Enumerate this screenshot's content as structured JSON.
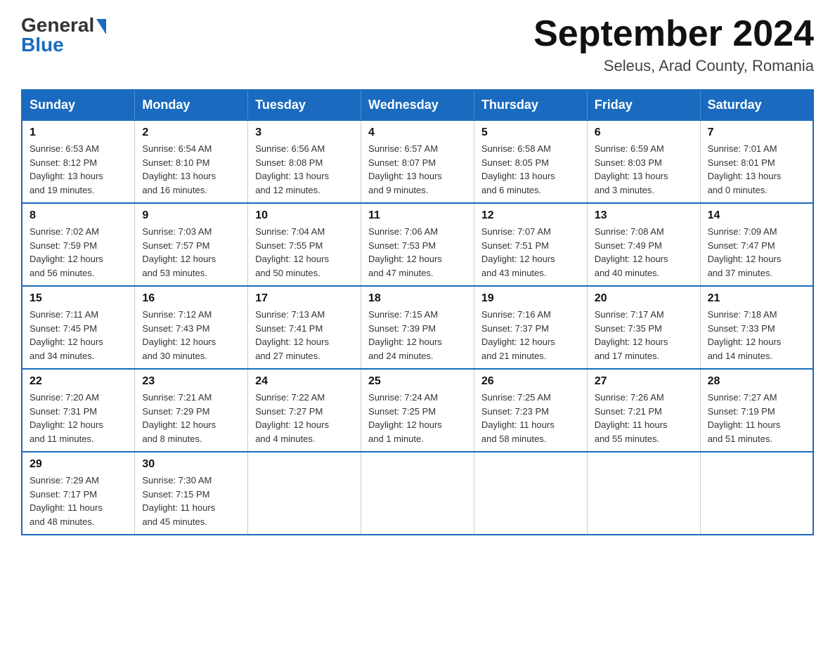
{
  "header": {
    "logo_general": "General",
    "logo_blue": "Blue",
    "month_title": "September 2024",
    "location": "Seleus, Arad County, Romania"
  },
  "calendar": {
    "headers": [
      "Sunday",
      "Monday",
      "Tuesday",
      "Wednesday",
      "Thursday",
      "Friday",
      "Saturday"
    ],
    "weeks": [
      [
        {
          "day": "1",
          "sunrise": "6:53 AM",
          "sunset": "8:12 PM",
          "daylight": "13 hours and 19 minutes."
        },
        {
          "day": "2",
          "sunrise": "6:54 AM",
          "sunset": "8:10 PM",
          "daylight": "13 hours and 16 minutes."
        },
        {
          "day": "3",
          "sunrise": "6:56 AM",
          "sunset": "8:08 PM",
          "daylight": "13 hours and 12 minutes."
        },
        {
          "day": "4",
          "sunrise": "6:57 AM",
          "sunset": "8:07 PM",
          "daylight": "13 hours and 9 minutes."
        },
        {
          "day": "5",
          "sunrise": "6:58 AM",
          "sunset": "8:05 PM",
          "daylight": "13 hours and 6 minutes."
        },
        {
          "day": "6",
          "sunrise": "6:59 AM",
          "sunset": "8:03 PM",
          "daylight": "13 hours and 3 minutes."
        },
        {
          "day": "7",
          "sunrise": "7:01 AM",
          "sunset": "8:01 PM",
          "daylight": "13 hours and 0 minutes."
        }
      ],
      [
        {
          "day": "8",
          "sunrise": "7:02 AM",
          "sunset": "7:59 PM",
          "daylight": "12 hours and 56 minutes."
        },
        {
          "day": "9",
          "sunrise": "7:03 AM",
          "sunset": "7:57 PM",
          "daylight": "12 hours and 53 minutes."
        },
        {
          "day": "10",
          "sunrise": "7:04 AM",
          "sunset": "7:55 PM",
          "daylight": "12 hours and 50 minutes."
        },
        {
          "day": "11",
          "sunrise": "7:06 AM",
          "sunset": "7:53 PM",
          "daylight": "12 hours and 47 minutes."
        },
        {
          "day": "12",
          "sunrise": "7:07 AM",
          "sunset": "7:51 PM",
          "daylight": "12 hours and 43 minutes."
        },
        {
          "day": "13",
          "sunrise": "7:08 AM",
          "sunset": "7:49 PM",
          "daylight": "12 hours and 40 minutes."
        },
        {
          "day": "14",
          "sunrise": "7:09 AM",
          "sunset": "7:47 PM",
          "daylight": "12 hours and 37 minutes."
        }
      ],
      [
        {
          "day": "15",
          "sunrise": "7:11 AM",
          "sunset": "7:45 PM",
          "daylight": "12 hours and 34 minutes."
        },
        {
          "day": "16",
          "sunrise": "7:12 AM",
          "sunset": "7:43 PM",
          "daylight": "12 hours and 30 minutes."
        },
        {
          "day": "17",
          "sunrise": "7:13 AM",
          "sunset": "7:41 PM",
          "daylight": "12 hours and 27 minutes."
        },
        {
          "day": "18",
          "sunrise": "7:15 AM",
          "sunset": "7:39 PM",
          "daylight": "12 hours and 24 minutes."
        },
        {
          "day": "19",
          "sunrise": "7:16 AM",
          "sunset": "7:37 PM",
          "daylight": "12 hours and 21 minutes."
        },
        {
          "day": "20",
          "sunrise": "7:17 AM",
          "sunset": "7:35 PM",
          "daylight": "12 hours and 17 minutes."
        },
        {
          "day": "21",
          "sunrise": "7:18 AM",
          "sunset": "7:33 PM",
          "daylight": "12 hours and 14 minutes."
        }
      ],
      [
        {
          "day": "22",
          "sunrise": "7:20 AM",
          "sunset": "7:31 PM",
          "daylight": "12 hours and 11 minutes."
        },
        {
          "day": "23",
          "sunrise": "7:21 AM",
          "sunset": "7:29 PM",
          "daylight": "12 hours and 8 minutes."
        },
        {
          "day": "24",
          "sunrise": "7:22 AM",
          "sunset": "7:27 PM",
          "daylight": "12 hours and 4 minutes."
        },
        {
          "day": "25",
          "sunrise": "7:24 AM",
          "sunset": "7:25 PM",
          "daylight": "12 hours and 1 minute."
        },
        {
          "day": "26",
          "sunrise": "7:25 AM",
          "sunset": "7:23 PM",
          "daylight": "11 hours and 58 minutes."
        },
        {
          "day": "27",
          "sunrise": "7:26 AM",
          "sunset": "7:21 PM",
          "daylight": "11 hours and 55 minutes."
        },
        {
          "day": "28",
          "sunrise": "7:27 AM",
          "sunset": "7:19 PM",
          "daylight": "11 hours and 51 minutes."
        }
      ],
      [
        {
          "day": "29",
          "sunrise": "7:29 AM",
          "sunset": "7:17 PM",
          "daylight": "11 hours and 48 minutes."
        },
        {
          "day": "30",
          "sunrise": "7:30 AM",
          "sunset": "7:15 PM",
          "daylight": "11 hours and 45 minutes."
        },
        null,
        null,
        null,
        null,
        null
      ]
    ]
  }
}
